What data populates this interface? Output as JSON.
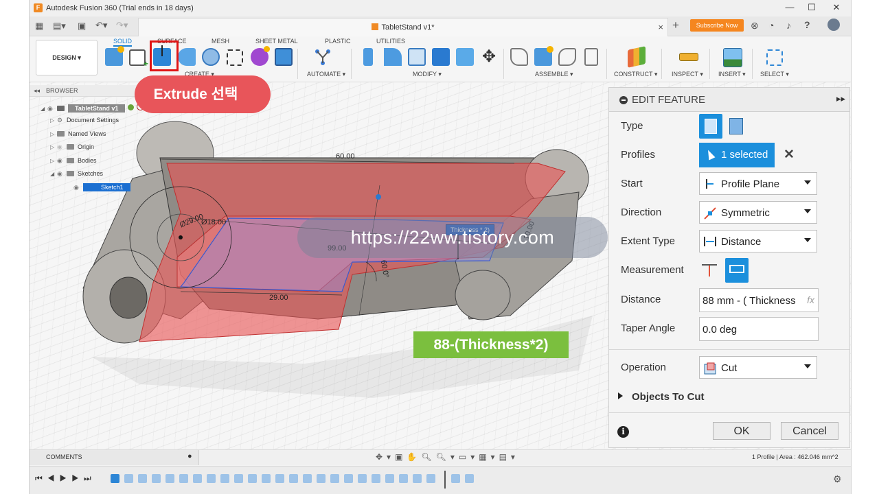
{
  "app": {
    "title": "Autodesk Fusion 360 (Trial ends in 18 days)",
    "logo_letter": "F",
    "window_controls": [
      "—",
      "☐",
      "✕"
    ]
  },
  "tabbar": {
    "doc_tab": "TabletStand v1*",
    "close": "×",
    "add": "+",
    "subscribe": "Subscribe Now"
  },
  "ribbon": {
    "workspace": "DESIGN ▾",
    "tabs": [
      "SOLID",
      "SURFACE",
      "MESH",
      "SHEET METAL",
      "PLASTIC",
      "UTILITIES"
    ],
    "groups": [
      "CREATE ▾",
      "AUTOMATE ▾",
      "MODIFY ▾",
      "ASSEMBLE ▾",
      "CONSTRUCT ▾",
      "INSPECT ▾",
      "INSERT ▾",
      "SELECT ▾"
    ]
  },
  "browser": {
    "header": "BROWSER",
    "nodes": [
      "TabletStand v1",
      "Document Settings",
      "Named Views",
      "Origin",
      "Bodies",
      "Sketches",
      "Sketch1"
    ]
  },
  "annotations": {
    "extrude_callout": "Extrude 선택",
    "watermark": "https://22ww.tistory.com",
    "thickness_callout": "88-(Thickness*2)"
  },
  "dimensions": {
    "d60": "60.00",
    "d29": "Ø29.00",
    "d18": "Ø18.00",
    "d99": "99.00",
    "d29b": "29.00",
    "angle": "60.0°",
    "d10": "10.00",
    "thickness_tag": "Thickness * 2)"
  },
  "edit_feature": {
    "title": "EDIT FEATURE",
    "expand": "▸▸",
    "type_label": "Type",
    "profiles_label": "Profiles",
    "profiles_value": "1 selected",
    "profiles_clear": "✕",
    "start_label": "Start",
    "start_value": "Profile Plane",
    "direction_label": "Direction",
    "direction_value": "Symmetric",
    "extent_label": "Extent Type",
    "extent_value": "Distance",
    "measurement_label": "Measurement",
    "distance_label": "Distance",
    "distance_value": "88 mm - ( Thickness",
    "fx": "fx",
    "taper_label": "Taper Angle",
    "taper_value": "0.0 deg",
    "operation_label": "Operation",
    "operation_value": "Cut",
    "objects_label": "Objects To Cut",
    "ok": "OK",
    "cancel": "Cancel",
    "info": "i"
  },
  "status": {
    "comments": "COMMENTS",
    "profile_info": "1 Profile | Area : 462.046 mm^2"
  },
  "colors": {
    "accent": "#1b8fdc",
    "subscribe": "#f5861f",
    "callout_red": "#e8555a",
    "callout_green": "#7bbf3e",
    "highlight_box": "#e01414"
  }
}
